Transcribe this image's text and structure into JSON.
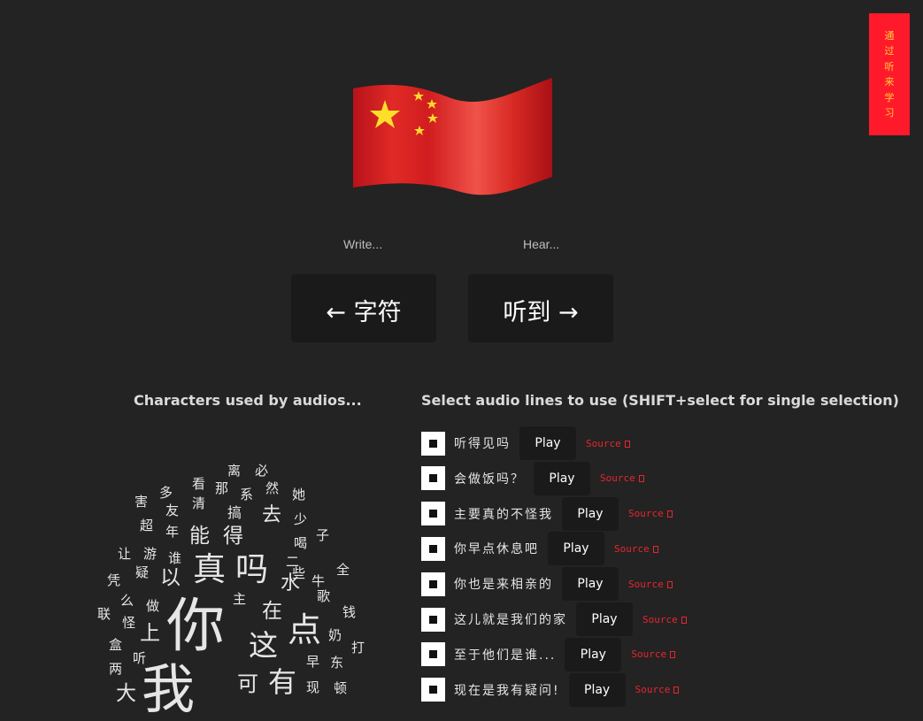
{
  "side_tab": {
    "chars": [
      "通",
      "过",
      "听",
      "来",
      "学",
      "习"
    ]
  },
  "hints": {
    "write": "Write...",
    "hear": "Hear..."
  },
  "nav": {
    "left_label": "← 字符",
    "right_label": "听到 →"
  },
  "titles": {
    "characters": "Characters used by audios...",
    "select": "Select audio lines to use (SHIFT+select for single selection)"
  },
  "play_label": "Play",
  "source_label": "Source",
  "lines": [
    {
      "text": "听得见吗"
    },
    {
      "text": "会做饭吗？"
    },
    {
      "text": "主要真的不怪我"
    },
    {
      "text": "你早点休息吧"
    },
    {
      "text": "你也是来相亲的"
    },
    {
      "text": "这儿就是我们的家"
    },
    {
      "text": "至于他们是谁..."
    },
    {
      "text": "现在是我有疑问!"
    }
  ],
  "word_cloud": [
    "离",
    "必",
    "看",
    "那",
    "然",
    "多",
    "系",
    "她",
    "害",
    "友",
    "清",
    "搞",
    "去",
    "少",
    "超",
    "年",
    "能",
    "得",
    "喝",
    "子",
    "让",
    "游",
    "谁",
    "二",
    "些",
    "真",
    "吗",
    "全",
    "凭",
    "疑",
    "以",
    "牛",
    "水",
    "歌",
    "联",
    "么",
    "做",
    "主",
    "你",
    "在",
    "钱",
    "怪",
    "上",
    "点",
    "奶",
    "盒",
    "这",
    "打",
    "两",
    "听",
    "早",
    "东",
    "我",
    "可",
    "有",
    "现",
    "顿",
    "大"
  ],
  "colors": {
    "side_tab_bg": "#ff1a2b",
    "side_tab_text": "#ffd23c",
    "source": "#e8252e",
    "button_bg": "#1a1a1a"
  }
}
